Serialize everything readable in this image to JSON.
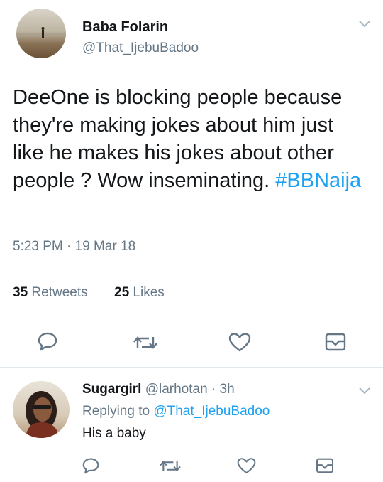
{
  "tweet": {
    "author_name": "Baba Folarin",
    "author_handle": "@That_IjebuBadoo",
    "text": "DeeOne is blocking people because they're making jokes about him just like he makes his jokes about other people ? Wow inseminating.",
    "hashtag": "#BBNaija",
    "timestamp": "5:23 PM · 19 Mar 18",
    "retweets_count": "35",
    "retweets_label": "Retweets",
    "likes_count": "25",
    "likes_label": "Likes"
  },
  "reply": {
    "author_name": "Sugargirl",
    "author_handle": "@larhotan",
    "time": "· 3h",
    "replying_to_label": "Replying to",
    "replying_to_handle": "@That_IjebuBadoo",
    "text": "His a baby"
  },
  "icons": [
    "chevron-down-icon",
    "reply-icon",
    "retweet-icon",
    "like-icon",
    "share-icon"
  ],
  "colors": {
    "link": "#1da1f2",
    "secondary": "#657786",
    "icon": "#657786",
    "divider": "#e1e8ed"
  }
}
